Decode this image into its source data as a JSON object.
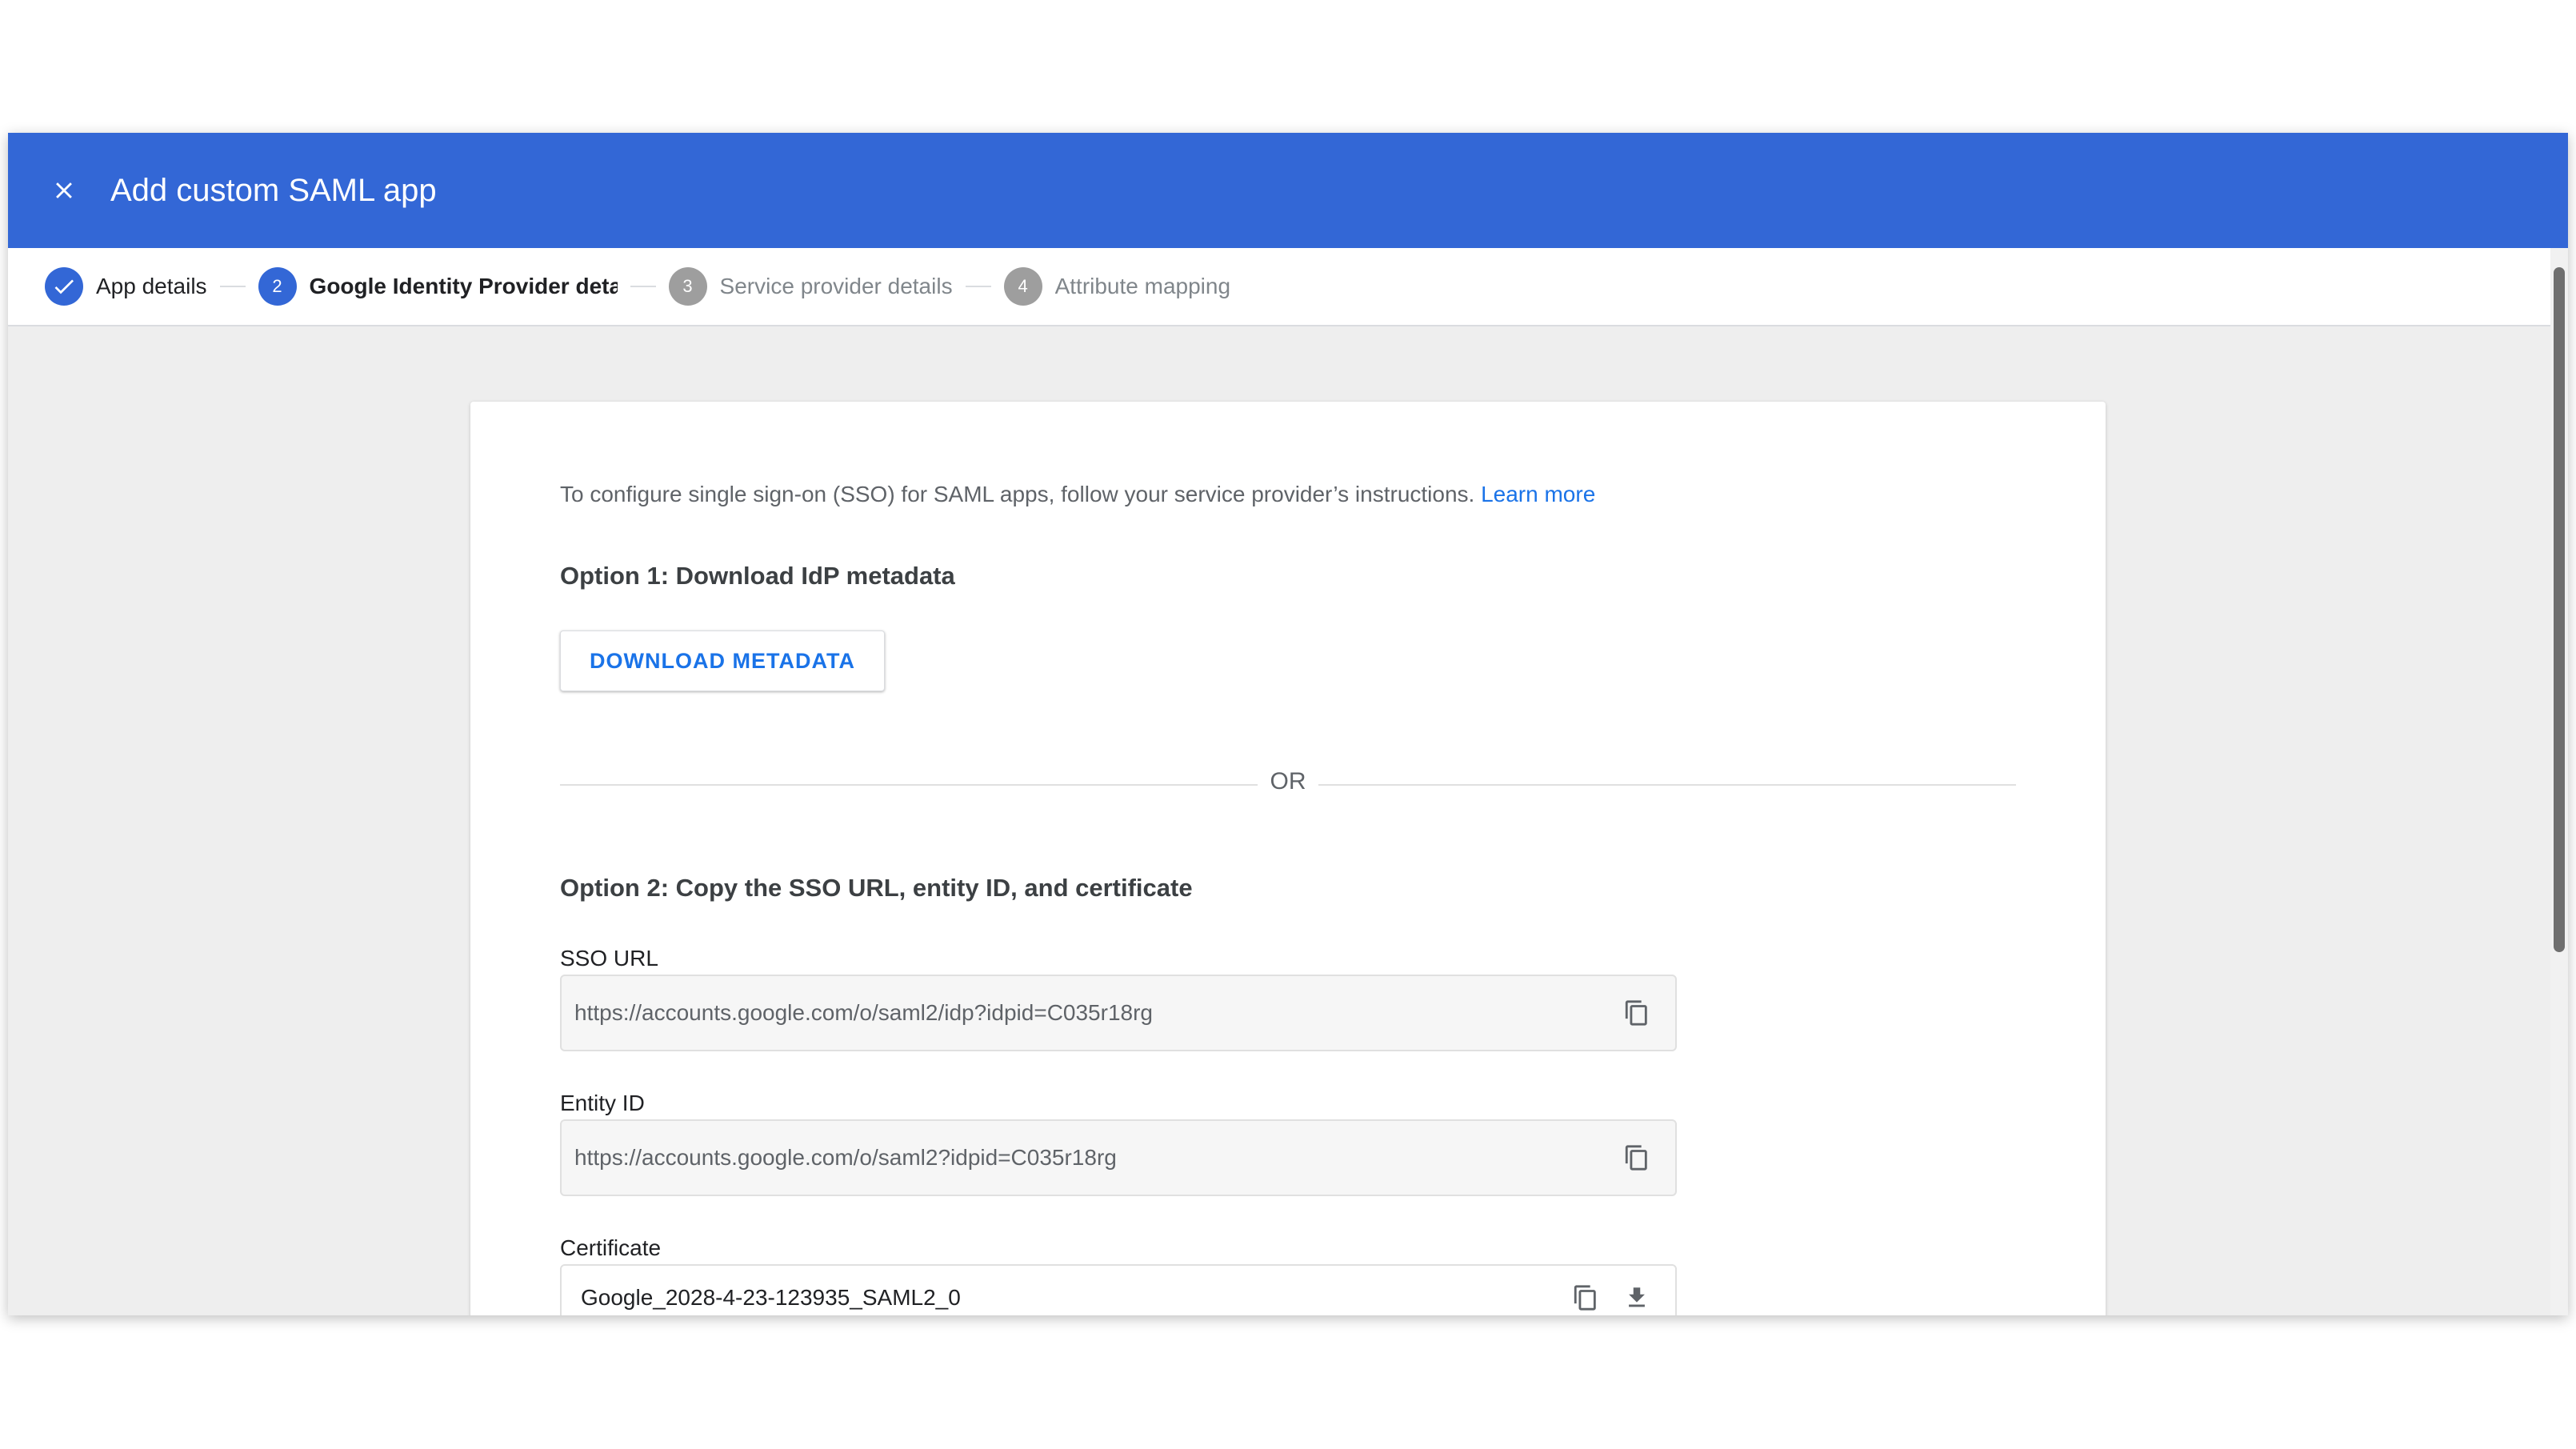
{
  "header": {
    "title": "Add custom SAML app"
  },
  "stepper": {
    "steps": [
      {
        "number": "",
        "label": "App details",
        "state": "done"
      },
      {
        "number": "2",
        "label": "Google Identity Provider details",
        "state": "active"
      },
      {
        "number": "3",
        "label": "Service provider details",
        "state": "pending"
      },
      {
        "number": "4",
        "label": "Attribute mapping",
        "state": "pending"
      }
    ]
  },
  "content": {
    "intro": "To configure single sign-on (SSO) for SAML apps, follow your service provider’s instructions.",
    "learn_more": "Learn more",
    "option1_heading": "Option 1: Download IdP metadata",
    "download_button": "DOWNLOAD METADATA",
    "or_text": "OR",
    "option2_heading": "Option 2: Copy the SSO URL, entity ID, and certificate",
    "fields": [
      {
        "label": "SSO URL",
        "value": "https://accounts.google.com/o/saml2/idp?idpid=C035r18rg"
      },
      {
        "label": "Entity ID",
        "value": "https://accounts.google.com/o/saml2?idpid=C035r18rg"
      },
      {
        "label": "Certificate",
        "value": "Google_2028-4-23-123935_SAML2_0"
      }
    ]
  },
  "icons": {
    "close": "close-icon",
    "check": "check-icon",
    "copy": "copy-icon",
    "download": "download-icon"
  },
  "colors": {
    "accent": "#3367d6",
    "link": "#1a73e8",
    "pending": "#9e9e9e"
  }
}
